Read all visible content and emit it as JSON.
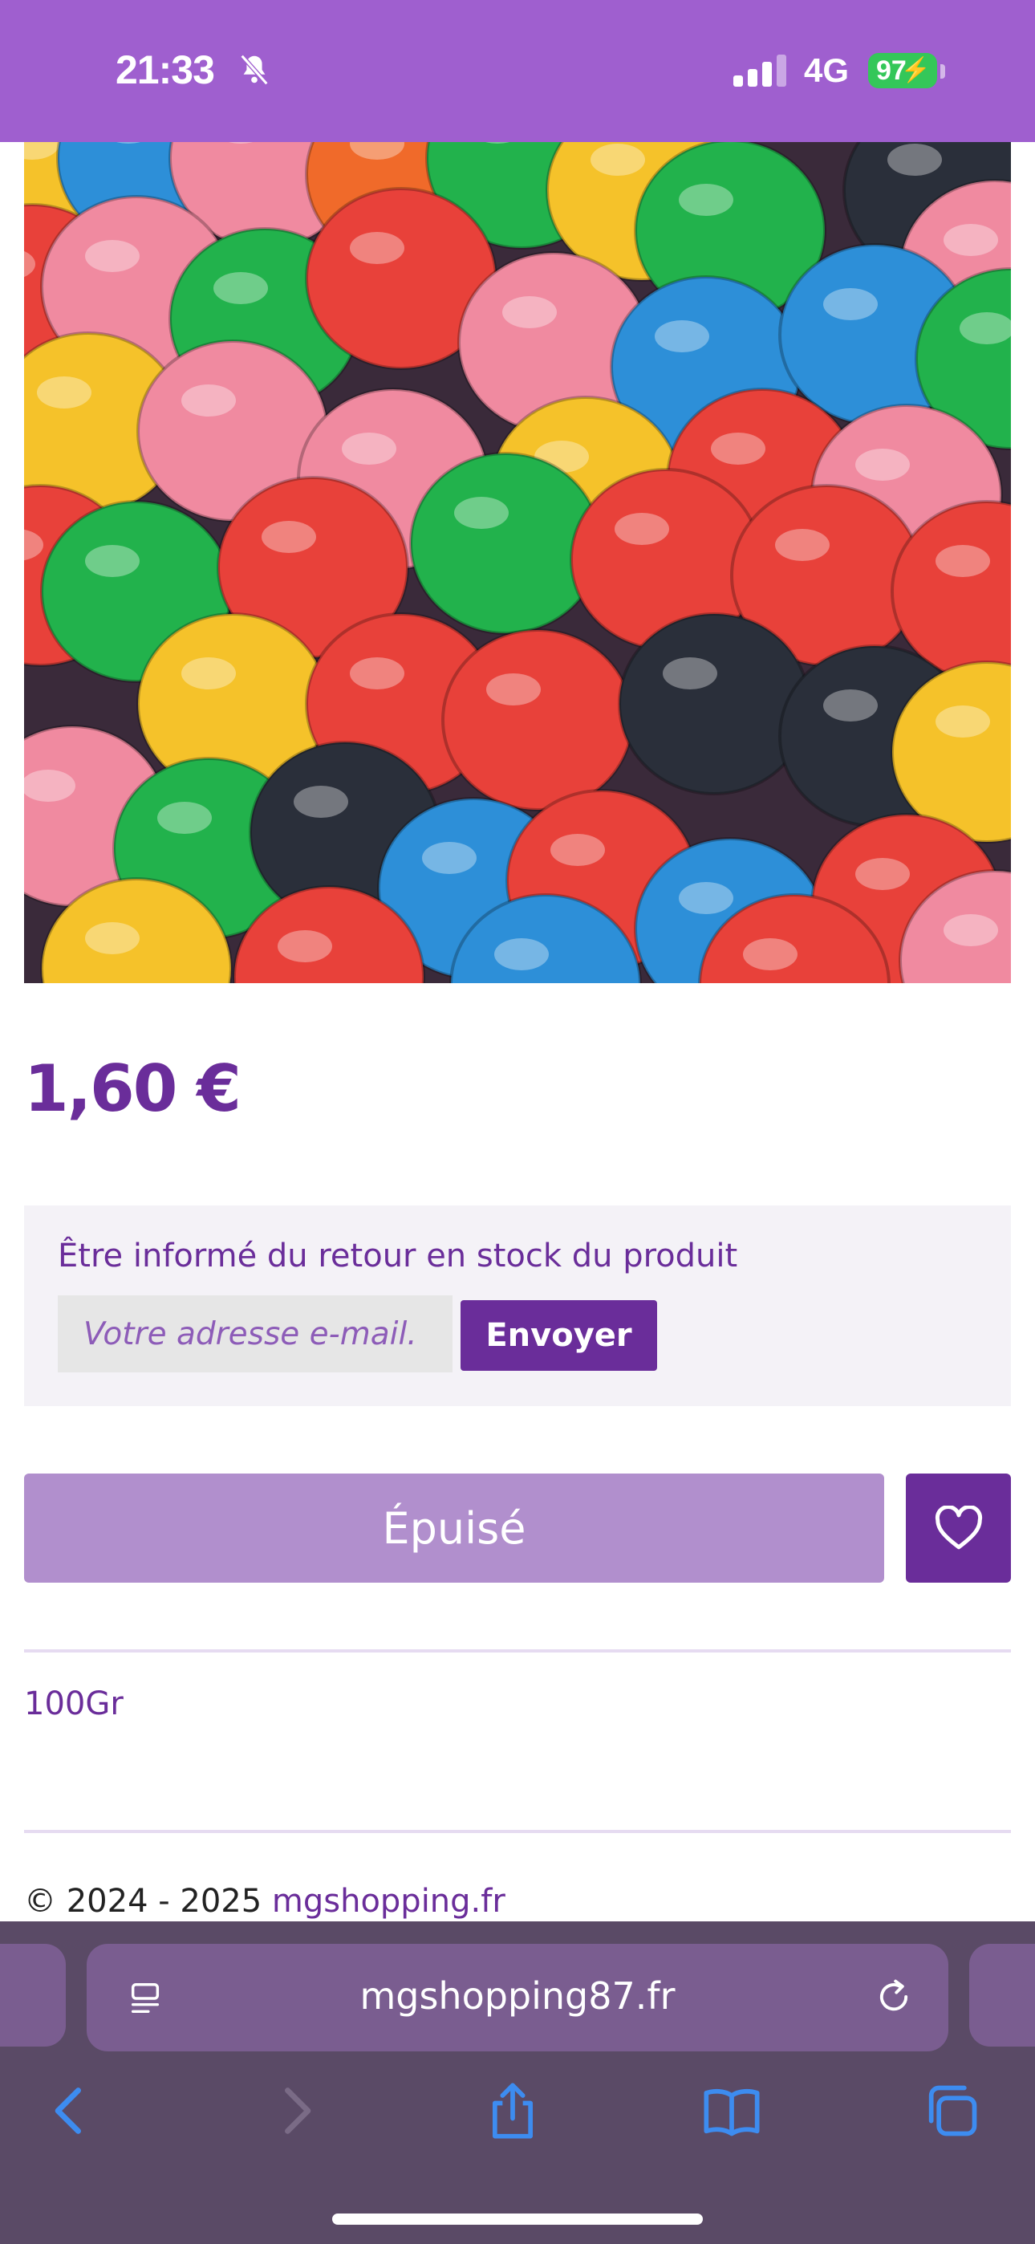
{
  "status_bar": {
    "time": "21:33",
    "network": "4G",
    "battery": "97",
    "icons": [
      "bell-slash-icon",
      "signal-icon",
      "battery-charging-icon"
    ]
  },
  "product": {
    "image_alt": "",
    "price": "1,60 €",
    "weight": "100Gr"
  },
  "stock_notify": {
    "title": "Être informé du retour en stock du produit",
    "email_placeholder": "Votre adresse e-mail.",
    "send_label": "Envoyer"
  },
  "actions": {
    "sold_out_label": "Épuisé",
    "wishlist_icon": "heart-icon"
  },
  "footer": {
    "copyright": "© 2024 - 2025 ",
    "link": "mgshopping.fr"
  },
  "browser": {
    "url": "mgshopping87.fr",
    "toolbar": [
      "back-icon",
      "forward-icon",
      "share-icon",
      "bookmarks-icon",
      "tabs-icon"
    ]
  },
  "colors": {
    "brand": "#6a2d9a",
    "status_bar": "#9f5fcf",
    "sold_out": "#b18fcd",
    "browser_bar": "#5a4a66",
    "ios_blue": "#3d8cf0"
  }
}
